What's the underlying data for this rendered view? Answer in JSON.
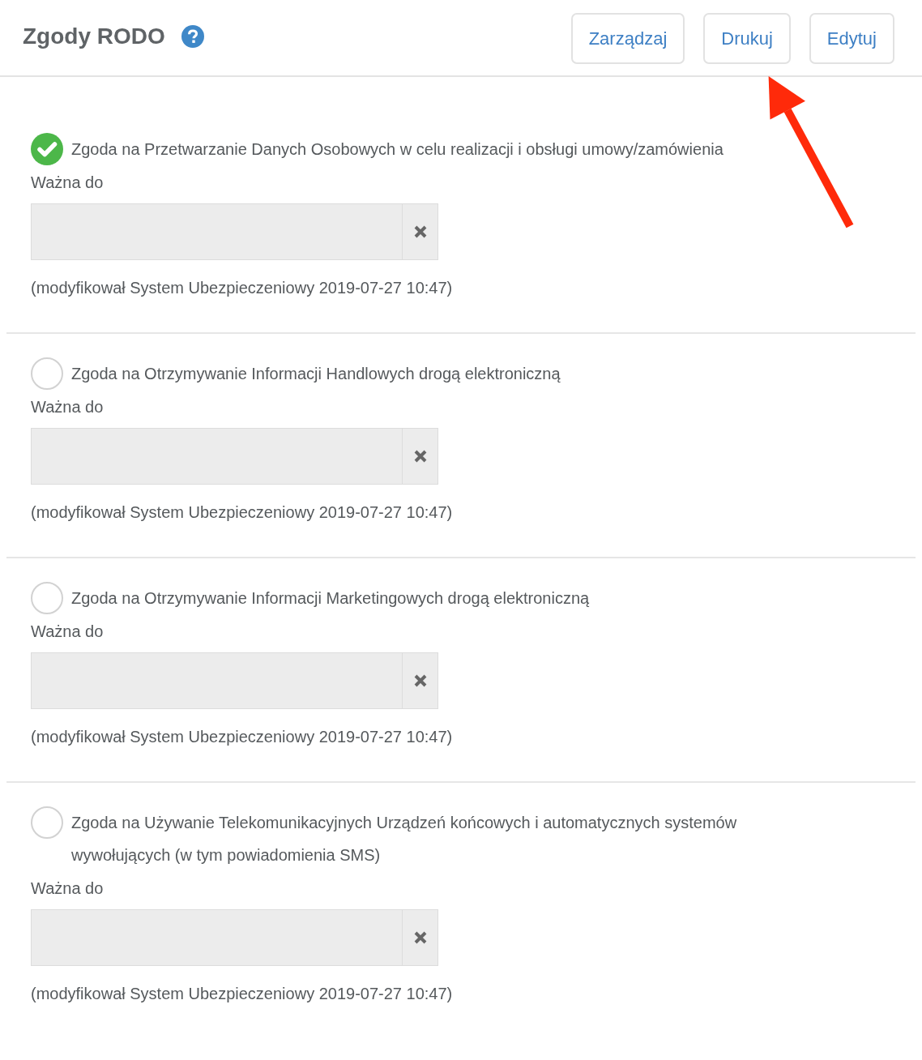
{
  "header": {
    "title": "Zgody RODO",
    "buttons": [
      {
        "label": "Zarządzaj",
        "highlighted": false
      },
      {
        "label": "Drukuj",
        "highlighted": true
      },
      {
        "label": "Edytuj",
        "highlighted": false
      }
    ]
  },
  "consents": [
    {
      "label": "Zgoda na Przetwarzanie Danych Osobowych w celu realizacji i obsługi umowy/zamówienia",
      "checked": true,
      "date_label": "Ważna do",
      "date_disabled": true,
      "modified": "(modyfikował System Ubezpieczeniowy 2019-07-27 10:47)"
    },
    {
      "label": "Zgoda na Otrzymywanie Informacji Handlowych drogą elektroniczną",
      "checked": false,
      "date_label": "Ważna do",
      "date_disabled": true,
      "modified": "(modyfikował System Ubezpieczeniowy 2019-07-27 10:47)"
    },
    {
      "label": "Zgoda na Otrzymywanie Informacji Marketingowych drogą elektroniczną",
      "checked": false,
      "date_label": "Ważna do",
      "date_disabled": true,
      "modified": "(modyfikował System Ubezpieczeniowy 2019-07-27 10:47)"
    },
    {
      "label": "Zgoda na Używanie Telekomunikacyjnych Urządzeń końcowych i automatycznych systemów wywołujących (w tym powiadomienia SMS)",
      "checked": false,
      "date_label": "Ważna do",
      "date_disabled": true,
      "modified": "(modyfikował System Ubezpieczeniowy 2019-07-27 10:47)"
    }
  ]
}
